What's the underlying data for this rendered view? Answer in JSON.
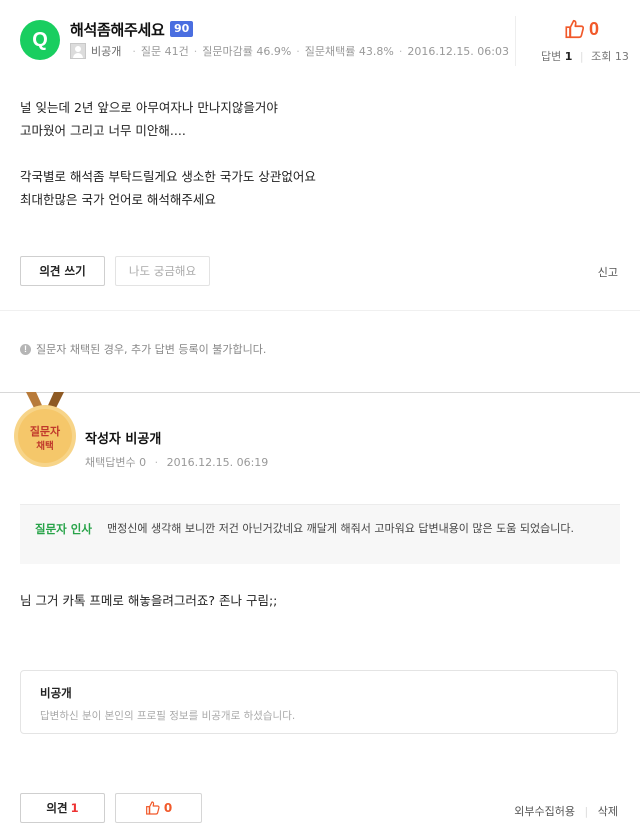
{
  "question": {
    "badge": "Q",
    "title": "해석좀해주세요",
    "points": "90",
    "author": "비공개",
    "meta": [
      "질문 41건",
      "질문마감률 46.9%",
      "질문채택률 43.8%",
      "2016.12.15. 06:03"
    ],
    "like_count": "0",
    "answer_label": "답변",
    "answer_count": "1",
    "view_label": "조회",
    "view_count": "13",
    "body_lines": [
      "널 잊는데 2년 앞으로 아무여자나 만나지않을거야",
      "고마웠어 그리고 너무 미안해....",
      "",
      "각국별로 해석좀 부탁드릴게요 생소한 국가도 상관없어요",
      "최대한많은 국가 언어로 해석해주세요"
    ],
    "opinion_button": "의견 쓰기",
    "curious_button": "나도 궁금해요",
    "report_link": "신고"
  },
  "notice": {
    "icon": "!",
    "text": "질문자 채택된 경우, 추가 답변 등록이 불가합니다."
  },
  "answer": {
    "medal_line1": "질문자",
    "medal_line2": "채택",
    "author": "작성자 비공개",
    "adopted_count": "채택답변수 0",
    "date": "2016.12.15. 06:19",
    "thanks_label": "질문자 인사",
    "thanks_text": "맨정신에 생각해 보니깐 저건 아닌거갔네요 깨달게 해줘서 고마워요 답변내용이 많은 도움 되었습니다.",
    "body": "님 그거 카톡 프메로 해놓을려그러죠? 존나 구림;;",
    "profile_title": "비공개",
    "profile_desc": "답변하신 분이 본인의 프로필 정보를 비공개로 하셨습니다.",
    "opinion_label": "의견",
    "opinion_count": "1",
    "like_count": "0",
    "external_link": "외부수집허용",
    "delete_link": "삭제"
  },
  "colors": {
    "green": "#19ce60",
    "points_blue": "#4a6ee0",
    "like_orange": "#f1592a",
    "thanks_green": "#27a348",
    "medal_gold": "#f5c76a"
  }
}
